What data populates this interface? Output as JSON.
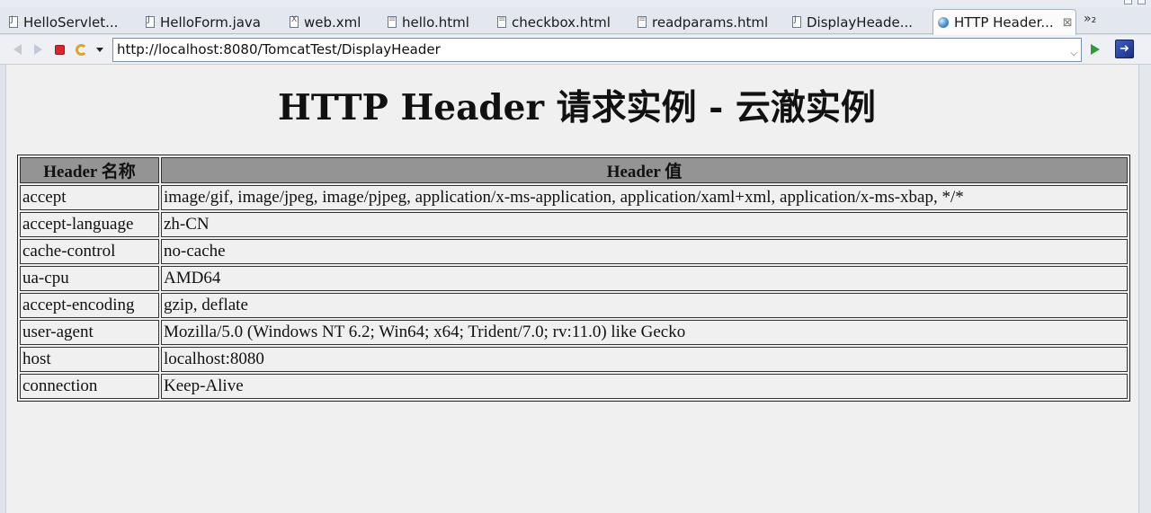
{
  "tabs": [
    {
      "label": "HelloServlet...",
      "icon": "java-file-icon"
    },
    {
      "label": "HelloForm.java",
      "icon": "java-file-icon"
    },
    {
      "label": "web.xml",
      "icon": "xml-file-icon"
    },
    {
      "label": "hello.html",
      "icon": "html-file-icon"
    },
    {
      "label": "checkbox.html",
      "icon": "html-file-icon"
    },
    {
      "label": "readparams.html",
      "icon": "html-file-icon"
    },
    {
      "label": "DisplayHeade...",
      "icon": "java-file-icon"
    },
    {
      "label": "HTTP Header...",
      "icon": "globe-icon",
      "active": true
    }
  ],
  "tabs_more": "»₂",
  "address": {
    "url": "http://localhost:8080/TomcatTest/DisplayHeader"
  },
  "page": {
    "title": "HTTP Header 请求实例 - 云澈实例",
    "table": {
      "headers": [
        "Header 名称",
        "Header 值"
      ],
      "rows": [
        [
          "accept",
          "image/gif, image/jpeg, image/pjpeg, application/x-ms-application, application/xaml+xml, application/x-ms-xbap, */*"
        ],
        [
          "accept-language",
          "zh-CN"
        ],
        [
          "cache-control",
          "no-cache"
        ],
        [
          "ua-cpu",
          "AMD64"
        ],
        [
          "accept-encoding",
          "gzip, deflate"
        ],
        [
          "user-agent",
          "Mozilla/5.0 (Windows NT 6.2; Win64; x64; Trident/7.0; rv:11.0) like Gecko"
        ],
        [
          "host",
          "localhost:8080"
        ],
        [
          "connection",
          "Keep-Alive"
        ]
      ]
    }
  }
}
